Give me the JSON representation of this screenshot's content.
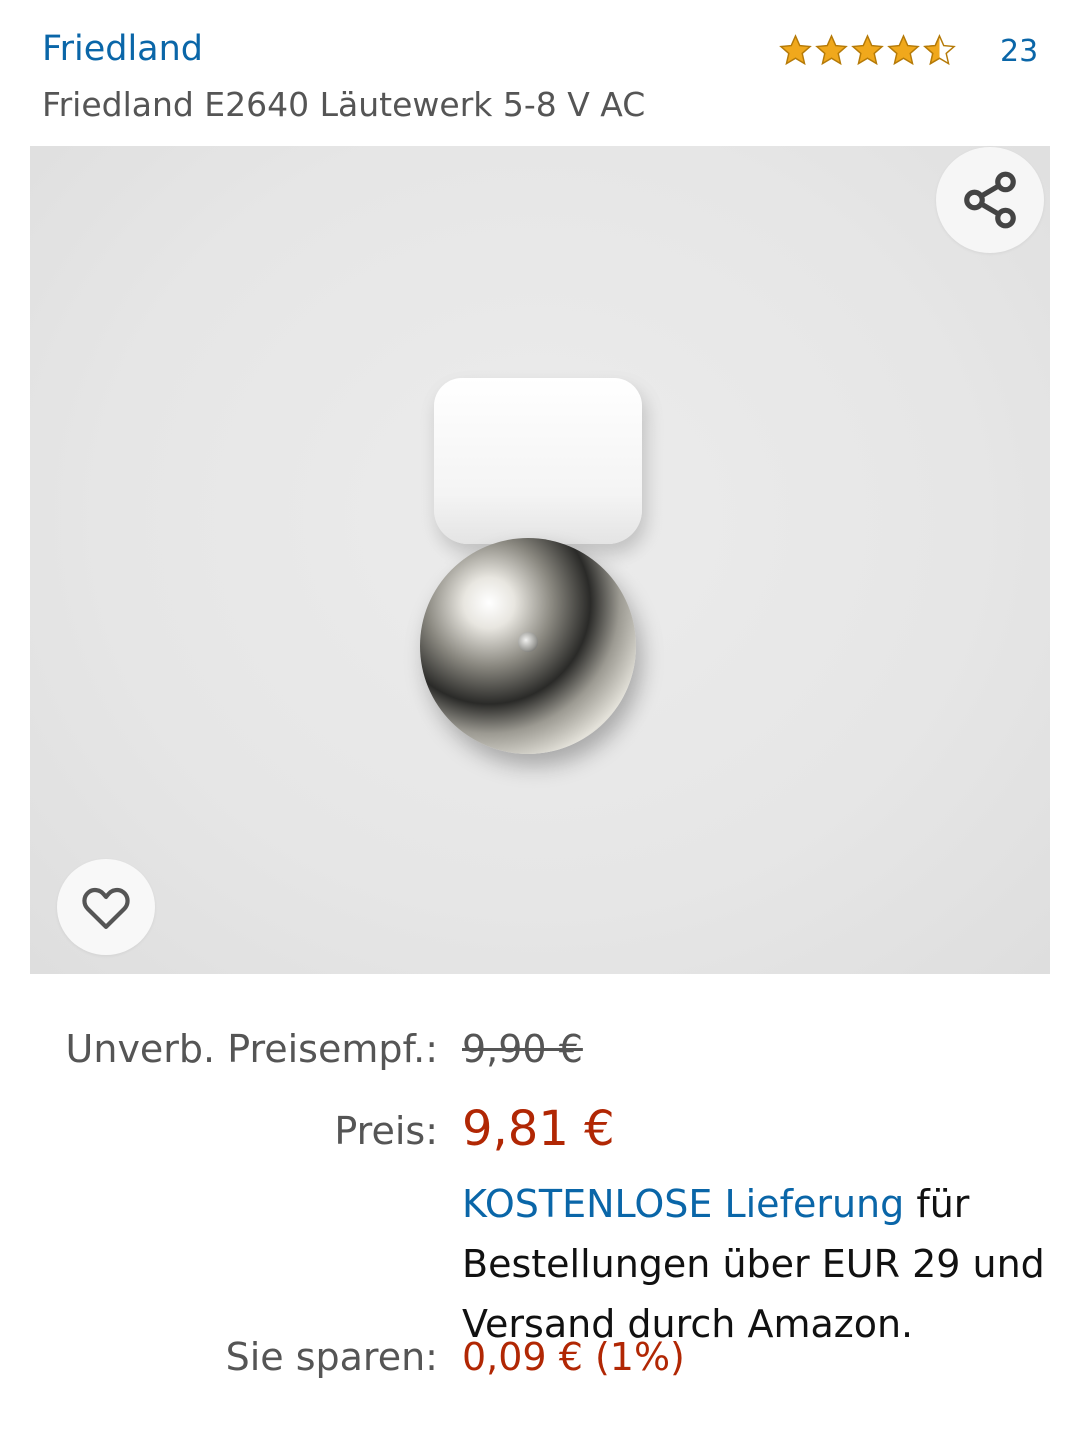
{
  "product": {
    "brand": "Friedland",
    "title": "Friedland E2640 Läutewerk 5-8 V AC",
    "rating": 4.5,
    "review_count": "23",
    "star_color": "#f0a81c"
  },
  "image": {
    "share_icon": "share-icon",
    "favorite_icon": "heart-outline-icon"
  },
  "pricing": {
    "list_price_label": "Unverb. Preisempf.:",
    "list_price": "9,90 €",
    "price_label": "Preis:",
    "price": "9,81 €",
    "delivery_link": "KOSTENLOSE Lieferung",
    "delivery_rest": " für Bestellungen über EUR 29 und Versand durch Amazon.",
    "savings_label": "Sie sparen:",
    "savings": "0,09 € (1%)",
    "price_color": "#b12704",
    "link_color": "#0a66a8"
  }
}
